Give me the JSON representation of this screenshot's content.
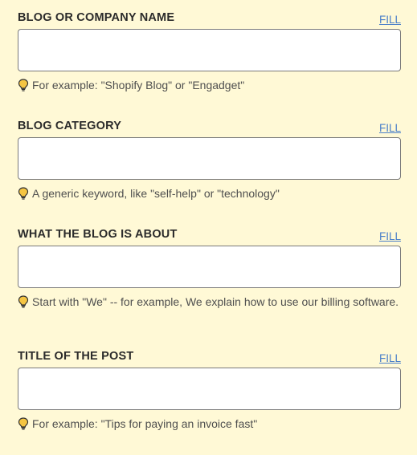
{
  "fields": [
    {
      "label": "BLOG OR COMPANY NAME",
      "fill_label": "FILL",
      "value": "",
      "placeholder": "",
      "hint": "For example: \"Shopify Blog\" or \"Engadget\""
    },
    {
      "label": "BLOG CATEGORY",
      "fill_label": "FILL",
      "value": "",
      "placeholder": "",
      "hint": "A generic keyword, like \"self-help\" or \"technology\""
    },
    {
      "label": "WHAT THE BLOG IS ABOUT",
      "fill_label": "FILL",
      "value": "",
      "placeholder": "",
      "hint": "Start with \"We\" -- for example, We explain how to use our billing software."
    },
    {
      "label": "TITLE OF THE POST",
      "fill_label": "FILL",
      "value": "",
      "placeholder": "",
      "hint": "For example: \"Tips for paying an invoice fast\""
    }
  ],
  "icons": {
    "hint_icon": "lightbulb-icon"
  },
  "colors": {
    "background": "#fff9d6",
    "link": "#4a7fc9",
    "bulb_fill": "#f5c542",
    "bulb_outline": "#333333"
  }
}
